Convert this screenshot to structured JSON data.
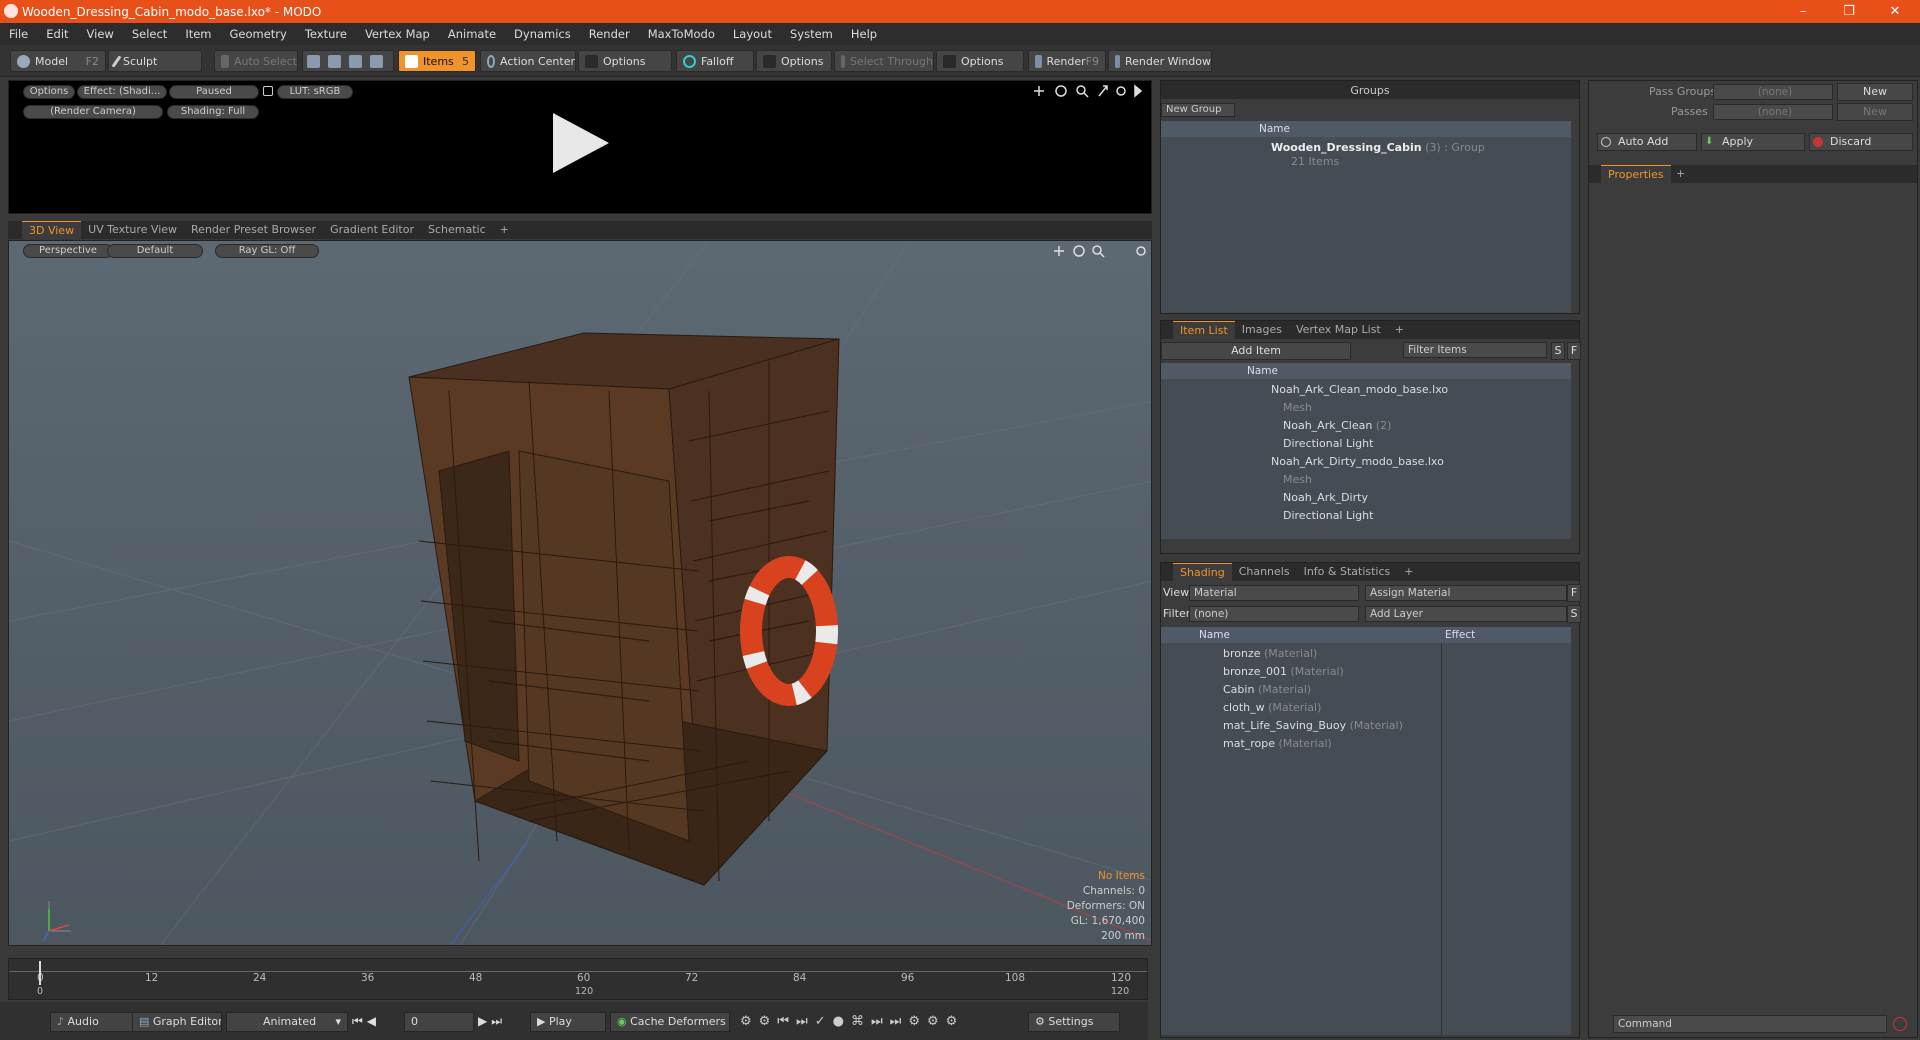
{
  "window": {
    "title": "Wooden_Dressing_Cabin_modo_base.lxo* - MODO",
    "minimize": "–",
    "restore": "❐",
    "close": "✕"
  },
  "menu": [
    "File",
    "Edit",
    "View",
    "Select",
    "Item",
    "Geometry",
    "Texture",
    "Vertex Map",
    "Animate",
    "Dynamics",
    "Render",
    "MaxToModo",
    "Layout",
    "System",
    "Help"
  ],
  "toolbar": {
    "model": "Model",
    "model_key": "F2",
    "sculpt": "Sculpt",
    "auto_select": "Auto Select",
    "items": "Items",
    "items_key": "5",
    "action_center": "Action Center",
    "options1": "Options",
    "falloff": "Falloff",
    "options2": "Options",
    "select_through": "Select Through",
    "options3": "Options",
    "render": "Render",
    "render_key": "F9",
    "render_window": "Render Window"
  },
  "preview": {
    "options": "Options",
    "effect": "Effect: (Shadi...",
    "paused": "Paused",
    "lut": "LUT: sRGB",
    "camera": "(Render Camera)",
    "shading": "Shading: Full"
  },
  "viewport_tabs": [
    "3D View",
    "UV Texture View",
    "Render Preset Browser",
    "Gradient Editor",
    "Schematic",
    "+"
  ],
  "viewport": {
    "perspective": "Perspective",
    "default": "Default",
    "raygl": "Ray GL: Off",
    "info": {
      "items": "No Items",
      "channels": "Channels: 0",
      "deformers": "Deformers: ON",
      "gl": "GL: 1,670,400",
      "scale": "200 mm"
    }
  },
  "timeline": {
    "ticks": [
      "0",
      "12",
      "24",
      "36",
      "48",
      "60",
      "72",
      "84",
      "96",
      "108",
      "120"
    ],
    "sub_ticks": [
      "0",
      "120",
      "120"
    ]
  },
  "bottom": {
    "audio": "Audio",
    "graph_editor": "Graph Editor",
    "animated": "Animated",
    "frame": "0",
    "play": "Play",
    "cache": "Cache Deformers",
    "settings": "Settings"
  },
  "groups": {
    "title": "Groups",
    "new_group": "New Group",
    "col_name": "Name",
    "item_name": "Wooden_Dressing_Cabin",
    "item_count": "(3)",
    "item_type": ": Group",
    "item_sub": "21 Items"
  },
  "item_list": {
    "tabs": [
      "Item List",
      "Images",
      "Vertex Map List",
      "+"
    ],
    "add_item": "Add Item",
    "filter": "Filter Items",
    "s": "S",
    "f": "F",
    "col_name": "Name",
    "rows": [
      {
        "label": "Noah_Ark_Clean_modo_base.lxo",
        "extra": "",
        "indent": 0,
        "dim": false
      },
      {
        "label": "Mesh",
        "extra": "",
        "indent": 2,
        "dim": true
      },
      {
        "label": "Noah_Ark_Clean",
        "extra": "(2)",
        "indent": 2,
        "dim": false
      },
      {
        "label": "Directional Light",
        "extra": "",
        "indent": 2,
        "dim": false
      },
      {
        "label": "Noah_Ark_Dirty_modo_base.lxo",
        "extra": "",
        "indent": 0,
        "dim": false
      },
      {
        "label": "Mesh",
        "extra": "",
        "indent": 2,
        "dim": true
      },
      {
        "label": "Noah_Ark_Dirty",
        "extra": "",
        "indent": 2,
        "dim": false
      },
      {
        "label": "Directional Light",
        "extra": "",
        "indent": 2,
        "dim": false
      }
    ]
  },
  "shading": {
    "tabs": [
      "Shading",
      "Channels",
      "Info & Statistics",
      "+"
    ],
    "view_label": "View",
    "view_value": "Material",
    "assign": "Assign Material",
    "f": "F",
    "filter_label": "Filter",
    "filter_value": "(none)",
    "add_layer": "Add Layer",
    "s": "S",
    "col_name": "Name",
    "col_effect": "Effect",
    "rows": [
      {
        "name": "bronze",
        "type": "(Material)"
      },
      {
        "name": "bronze_001",
        "type": "(Material)"
      },
      {
        "name": "Cabin",
        "type": "(Material)"
      },
      {
        "name": "cloth_w",
        "type": "(Material)"
      },
      {
        "name": "mat_Life_Saving_Buoy",
        "type": "(Material)"
      },
      {
        "name": "mat_rope",
        "type": "(Material)"
      }
    ]
  },
  "properties": {
    "pass_groups": "Pass Groups",
    "pass_groups_value": "(none)",
    "new1": "New",
    "passes": "Passes",
    "passes_value": "(none)",
    "new2": "New",
    "auto_add": "Auto Add",
    "apply": "Apply",
    "discard": "Discard",
    "tab": "Properties",
    "tab_add": "+",
    "command": "Command"
  },
  "colors": {
    "accent": "#f0932b",
    "title_bar": "#e8501a",
    "viewport_bg": "#5a6670",
    "wood": "#5a3a22",
    "buoy": "#d8421e"
  }
}
